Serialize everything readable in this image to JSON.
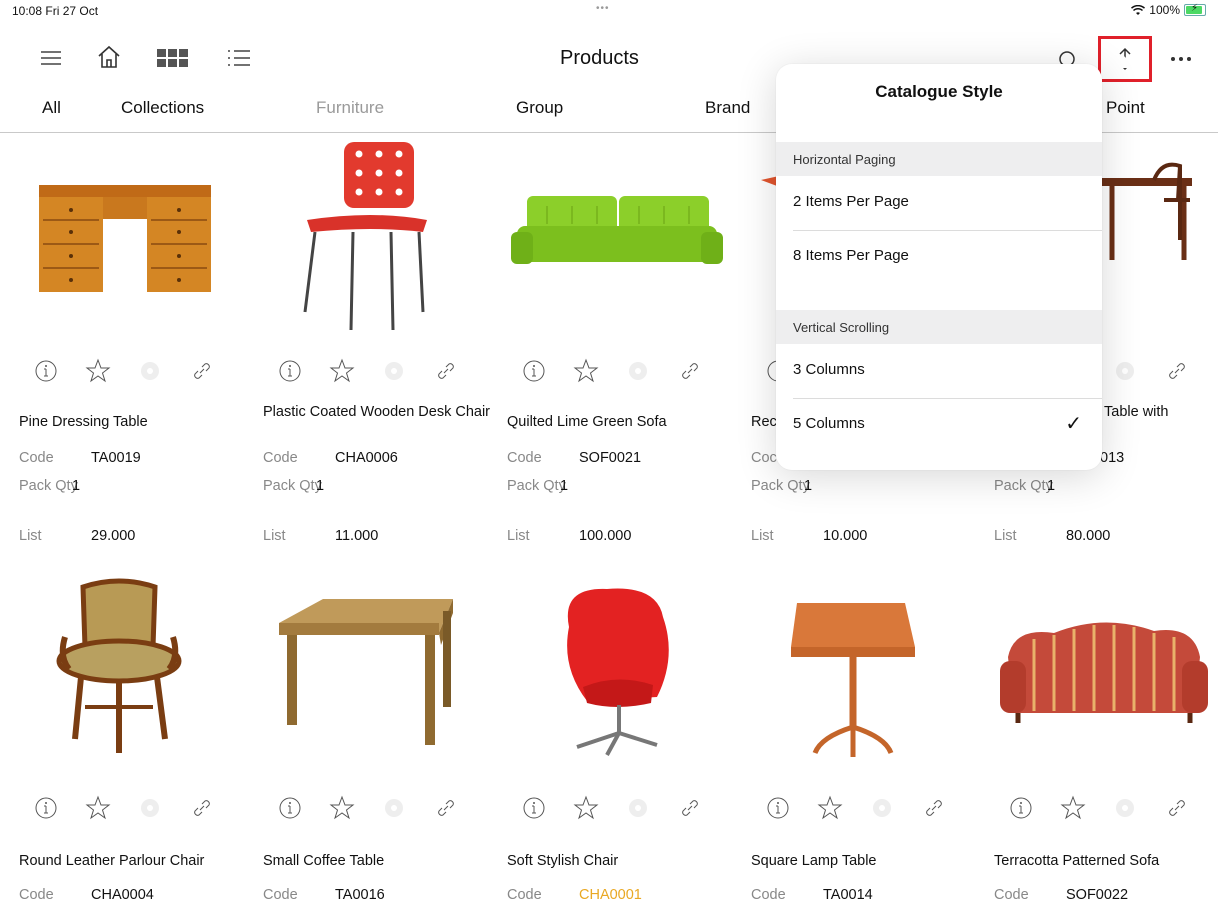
{
  "status": {
    "time": "10:08  Fri 27 Oct",
    "dots": "•••",
    "wifi": "wifi-icon",
    "battery": "100%"
  },
  "nav": {
    "title": "Products",
    "icons": [
      "menu-icon",
      "home-icon",
      "grid-icon",
      "list-icon",
      "search-icon",
      "sort-icon",
      "more-icon"
    ]
  },
  "tabs": [
    "All",
    "Collections",
    "Furniture",
    "Group",
    "Brand",
    "Point"
  ],
  "popover": {
    "title": "Catalogue Style",
    "sections": [
      {
        "header": "Horizontal Paging",
        "items": [
          "2 Items Per Page",
          "8 Items Per Page"
        ]
      },
      {
        "header": "Vertical Scrolling",
        "items": [
          "3 Columns",
          "5 Columns"
        ]
      }
    ],
    "selected": "5 Columns",
    "check": "✓"
  },
  "labels": {
    "code": "Code",
    "pack_qty": "Pack Qty",
    "list": "List"
  },
  "products": [
    {
      "name": "Pine Dressing Table",
      "code": "TA0019",
      "pack_qty": "1",
      "list": "29.000"
    },
    {
      "name": "Plastic Coated Wooden Desk Chair",
      "code": "CHA0006",
      "pack_qty": "1",
      "list": "11.000"
    },
    {
      "name": "Quilted Lime Green Sofa",
      "code": "SOF0021",
      "pack_qty": "1",
      "list": "100.000"
    },
    {
      "name": "Rec",
      "code": "",
      "pack_qty": "1",
      "list": "10.000",
      "code_label": "Coc"
    },
    {
      "name": "Table with",
      "code": "013",
      "pack_qty": "1",
      "list": "80.000"
    },
    {
      "name": "Round Leather Parlour Chair",
      "code": "CHA0004"
    },
    {
      "name": "Small Coffee Table",
      "code": "TA0016"
    },
    {
      "name": "Soft Stylish Chair",
      "code": "CHA0001"
    },
    {
      "name": "Square Lamp Table",
      "code": "TA0014"
    },
    {
      "name": "Terracotta Patterned Sofa",
      "code": "SOF0022"
    }
  ],
  "colors": {
    "highlight": "#e0202a",
    "warning_code": "#e9a823"
  }
}
